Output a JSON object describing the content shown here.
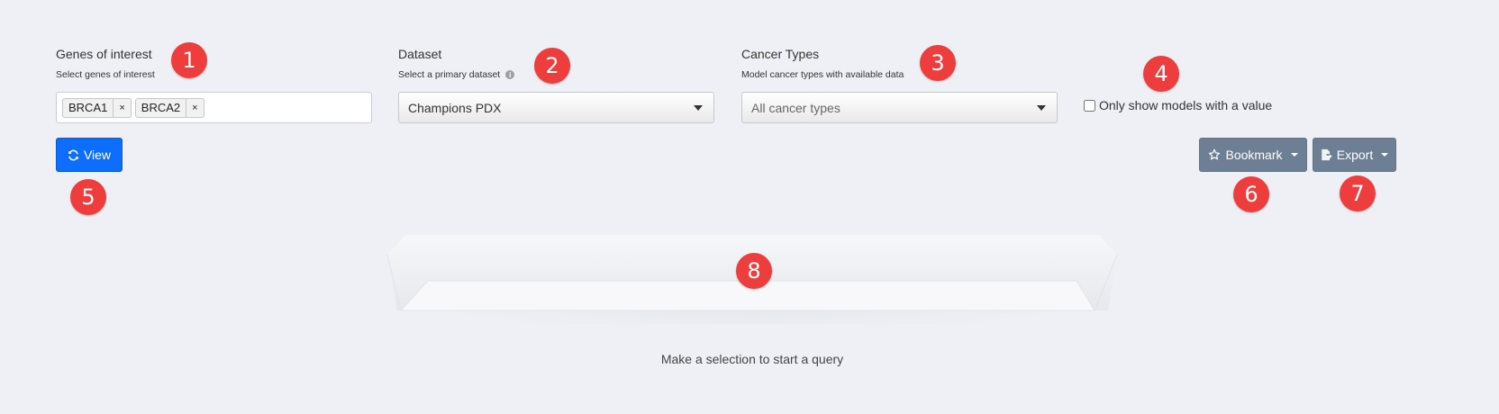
{
  "genes": {
    "label": "Genes of interest",
    "sublabel": "Select genes of interest",
    "chips": [
      {
        "text": "BRCA1",
        "remove": "×"
      },
      {
        "text": "BRCA2",
        "remove": "×"
      }
    ]
  },
  "dataset": {
    "label": "Dataset",
    "sublabel": "Select a primary dataset",
    "selected": "Champions PDX"
  },
  "cancer": {
    "label": "Cancer Types",
    "sublabel": "Model cancer types with available data",
    "placeholder": "All cancer types"
  },
  "filter": {
    "checkbox_label": "Only show models with a value"
  },
  "actions": {
    "view_label": "View",
    "bookmark_label": "Bookmark",
    "export_label": "Export"
  },
  "empty_state": {
    "message": "Make a selection to start a query"
  },
  "badges": [
    "1",
    "2",
    "3",
    "4",
    "5",
    "6",
    "7",
    "8"
  ],
  "colors": {
    "background": "#eef0f5",
    "primary": "#0d6efd",
    "secondary": "#6c7f94",
    "badge": "#ee3d3d"
  }
}
